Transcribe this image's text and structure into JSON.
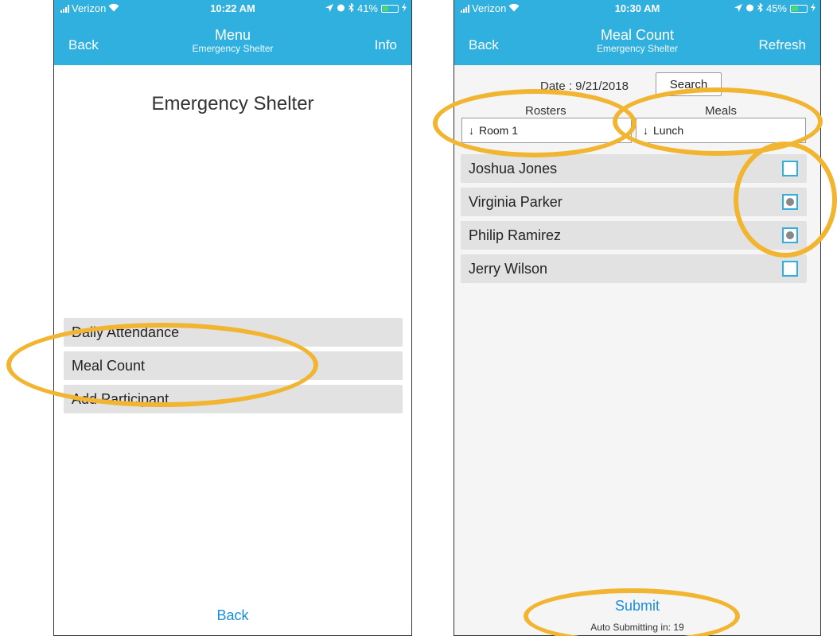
{
  "colors": {
    "nav": "#2fb0de",
    "link": "#1a8fd9",
    "highlight": "#f2b531",
    "row": "#e2e2e2"
  },
  "screen1": {
    "status": {
      "carrier": "Verizon",
      "time": "10:22 AM",
      "battery": "41%",
      "battery_level": 0.41
    },
    "nav": {
      "back": "Back",
      "title": "Menu",
      "subtitle": "Emergency Shelter",
      "action": "Info"
    },
    "heading": "Emergency Shelter",
    "menu": [
      {
        "label": "Daily Attendance"
      },
      {
        "label": "Meal Count"
      },
      {
        "label": "Add Participant"
      }
    ],
    "bottom_back": "Back"
  },
  "screen2": {
    "status": {
      "carrier": "Verizon",
      "time": "10:30 AM",
      "battery": "45%",
      "battery_level": 0.45
    },
    "nav": {
      "back": "Back",
      "title": "Meal Count",
      "subtitle": "Emergency Shelter",
      "action": "Refresh"
    },
    "date_label": "Date : 9/21/2018",
    "search": "Search",
    "rosters_label": "Rosters",
    "meals_label": "Meals",
    "roster_value": "Room 1",
    "meal_value": "Lunch",
    "arrow": "↓",
    "people": [
      {
        "name": "Joshua Jones",
        "checked": false
      },
      {
        "name": "Virginia Parker",
        "checked": true
      },
      {
        "name": "Philip Ramirez",
        "checked": true
      },
      {
        "name": "Jerry Wilson",
        "checked": false
      }
    ],
    "submit": "Submit",
    "auto_submit": "Auto Submitting in: 19"
  }
}
